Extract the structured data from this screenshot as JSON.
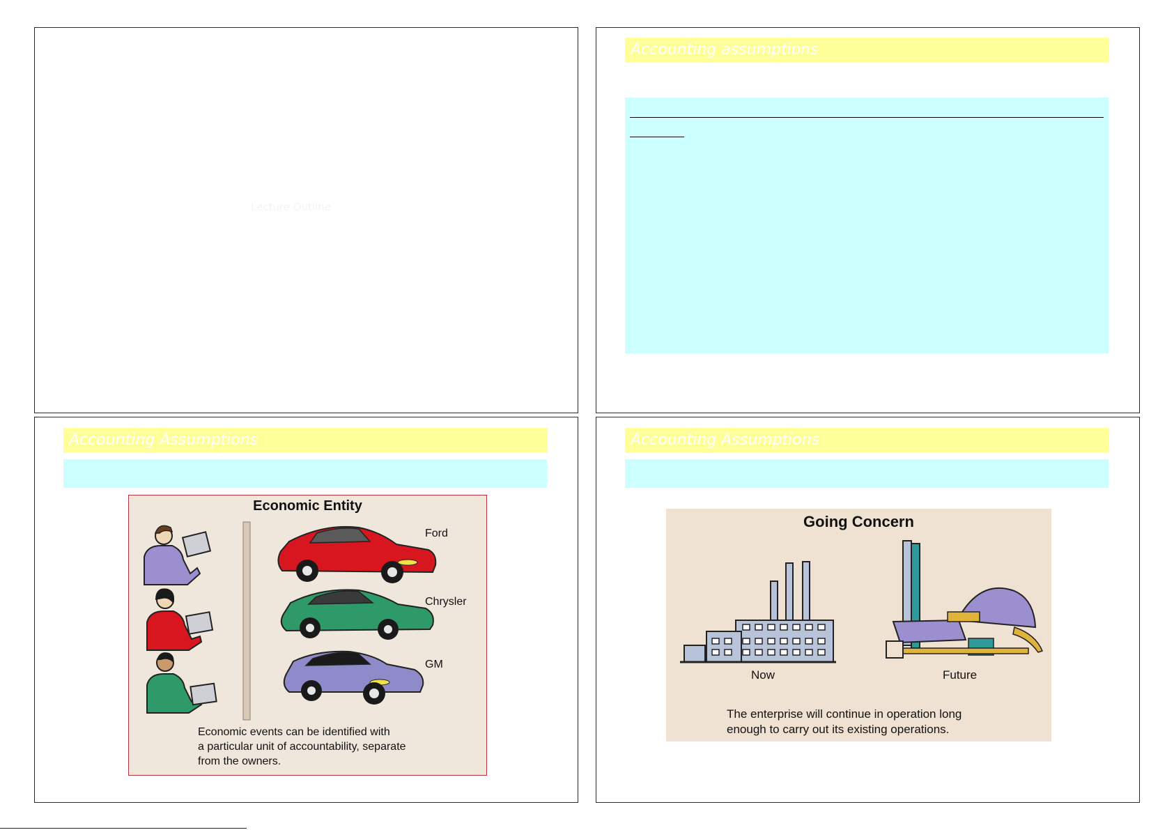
{
  "slides": {
    "slide1": {
      "faint_text": "Lecture Outline"
    },
    "slide2": {
      "title": "Accounting assumptions"
    },
    "slide3": {
      "title": "Accounting Assumptions",
      "figure": {
        "title": "Economic Entity",
        "labels": [
          "Ford",
          "Chrysler",
          "GM"
        ],
        "caption_lines": [
          "Economic events can be identified with",
          "a particular unit of accountability, separate",
          "from the owners."
        ]
      }
    },
    "slide4": {
      "title": "Accounting Assumptions",
      "figure": {
        "title": "Going Concern",
        "left_label": "Now",
        "right_label": "Future",
        "caption_lines": [
          "The enterprise will continue in operation long",
          "enough to carry out its existing operations."
        ]
      }
    }
  },
  "colors": {
    "title_bar": "#ffff99",
    "content_box": "#ccffff",
    "figure_border": "#b8323a",
    "ford": "#d8161f",
    "chrysler": "#2f9a69",
    "gm": "#8f8ac9"
  }
}
